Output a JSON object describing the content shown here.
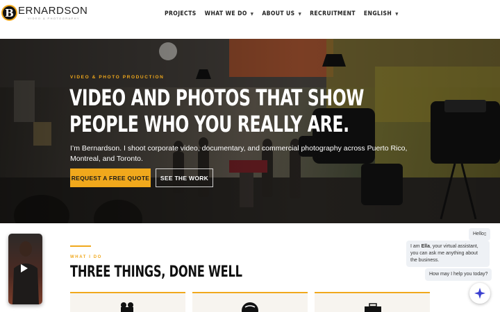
{
  "brand": {
    "logo_letter": "B",
    "name": "ERNARDSON",
    "tagline": "VIDEO & PHOTOGRAPHY",
    "accent_color": "#f0a81c"
  },
  "nav": {
    "items": [
      {
        "label": "PROJECTS",
        "has_dropdown": false
      },
      {
        "label": "WHAT WE DO",
        "has_dropdown": true
      },
      {
        "label": "ABOUT US",
        "has_dropdown": true
      },
      {
        "label": "RECRUITMENT",
        "has_dropdown": false
      },
      {
        "label": "ENGLISH",
        "has_dropdown": true
      }
    ],
    "caret_glyph": "▼"
  },
  "hero": {
    "eyebrow": "VIDEO & PHOTO PRODUCTION",
    "title": "VIDEO AND PHOTOS THAT SHOW PEOPLE WHO YOU REALLY ARE.",
    "description": "I’m Bernardson. I shoot corporate video, documentary, and commercial photography across Puerto Rico, Montreal, and Toronto.",
    "primary_button": "REQUEST A FREE QUOTE",
    "secondary_button": "SEE THE WORK"
  },
  "section": {
    "eyebrow": "WHAT I DO",
    "title": "THREE THINGS, DONE WELL",
    "cards": [
      {
        "icon": "camera-icon",
        "glyph": "🎥"
      },
      {
        "icon": "globe-icon",
        "glyph": "🌐"
      },
      {
        "icon": "briefcase-icon",
        "glyph": "💼"
      }
    ]
  },
  "chat": {
    "greeting": "Hello",
    "intro_prefix": "I am ",
    "assistant_name": "Ella",
    "intro_suffix": ", your virtual assistant, you can ask me anything about the business.",
    "prompt": "How may I help you today?"
  },
  "video_widget": {
    "icon": "play-icon"
  }
}
